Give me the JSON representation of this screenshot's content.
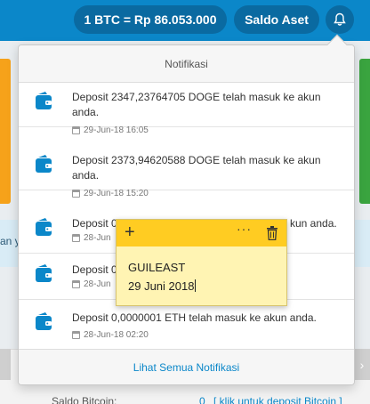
{
  "topbar": {
    "rate_label": "1 BTC = Rp 86.053.000",
    "saldo_label": "Saldo Aset",
    "bell_icon": "bell-icon"
  },
  "background": {
    "info_text": "an y",
    "saldo_label": "Saldo Bitcoin:",
    "saldo_value": "0",
    "deposit_link": "[ klik untuk deposit Bitcoin ]",
    "colors": {
      "topbar": "#0b87c9",
      "orange": "#f6a21a",
      "green": "#3aa43f"
    }
  },
  "notifications": {
    "header": "Notifikasi",
    "footer_link": "Lihat Semua Notifikasi",
    "items": [
      {
        "message": "Deposit 2347,23764705 DOGE telah masuk ke akun anda.",
        "date": "29-Jun-18 16:05",
        "icon": "wallet-icon"
      },
      {
        "message": "Deposit 2373,94620588 DOGE telah masuk ke akun anda.",
        "date": "29-Jun-18 15:20",
        "icon": "wallet-icon"
      },
      {
        "message": "Deposit 0",
        "message_tail": "kun anda.",
        "date": "28-Jun",
        "icon": "wallet-icon"
      },
      {
        "message": "Deposit 0",
        "message_tail": "",
        "date": "28-Jun",
        "icon": "wallet-icon"
      },
      {
        "message": "Deposit 0,0000001 ETH telah masuk ke akun anda.",
        "date": "28-Jun-18 02:20",
        "icon": "wallet-icon"
      }
    ]
  },
  "sticky": {
    "line1": "GUILEAST",
    "line2": "29 Juni 2018",
    "plus_label": "+",
    "more_label": "···",
    "color": "#ffcc22"
  }
}
